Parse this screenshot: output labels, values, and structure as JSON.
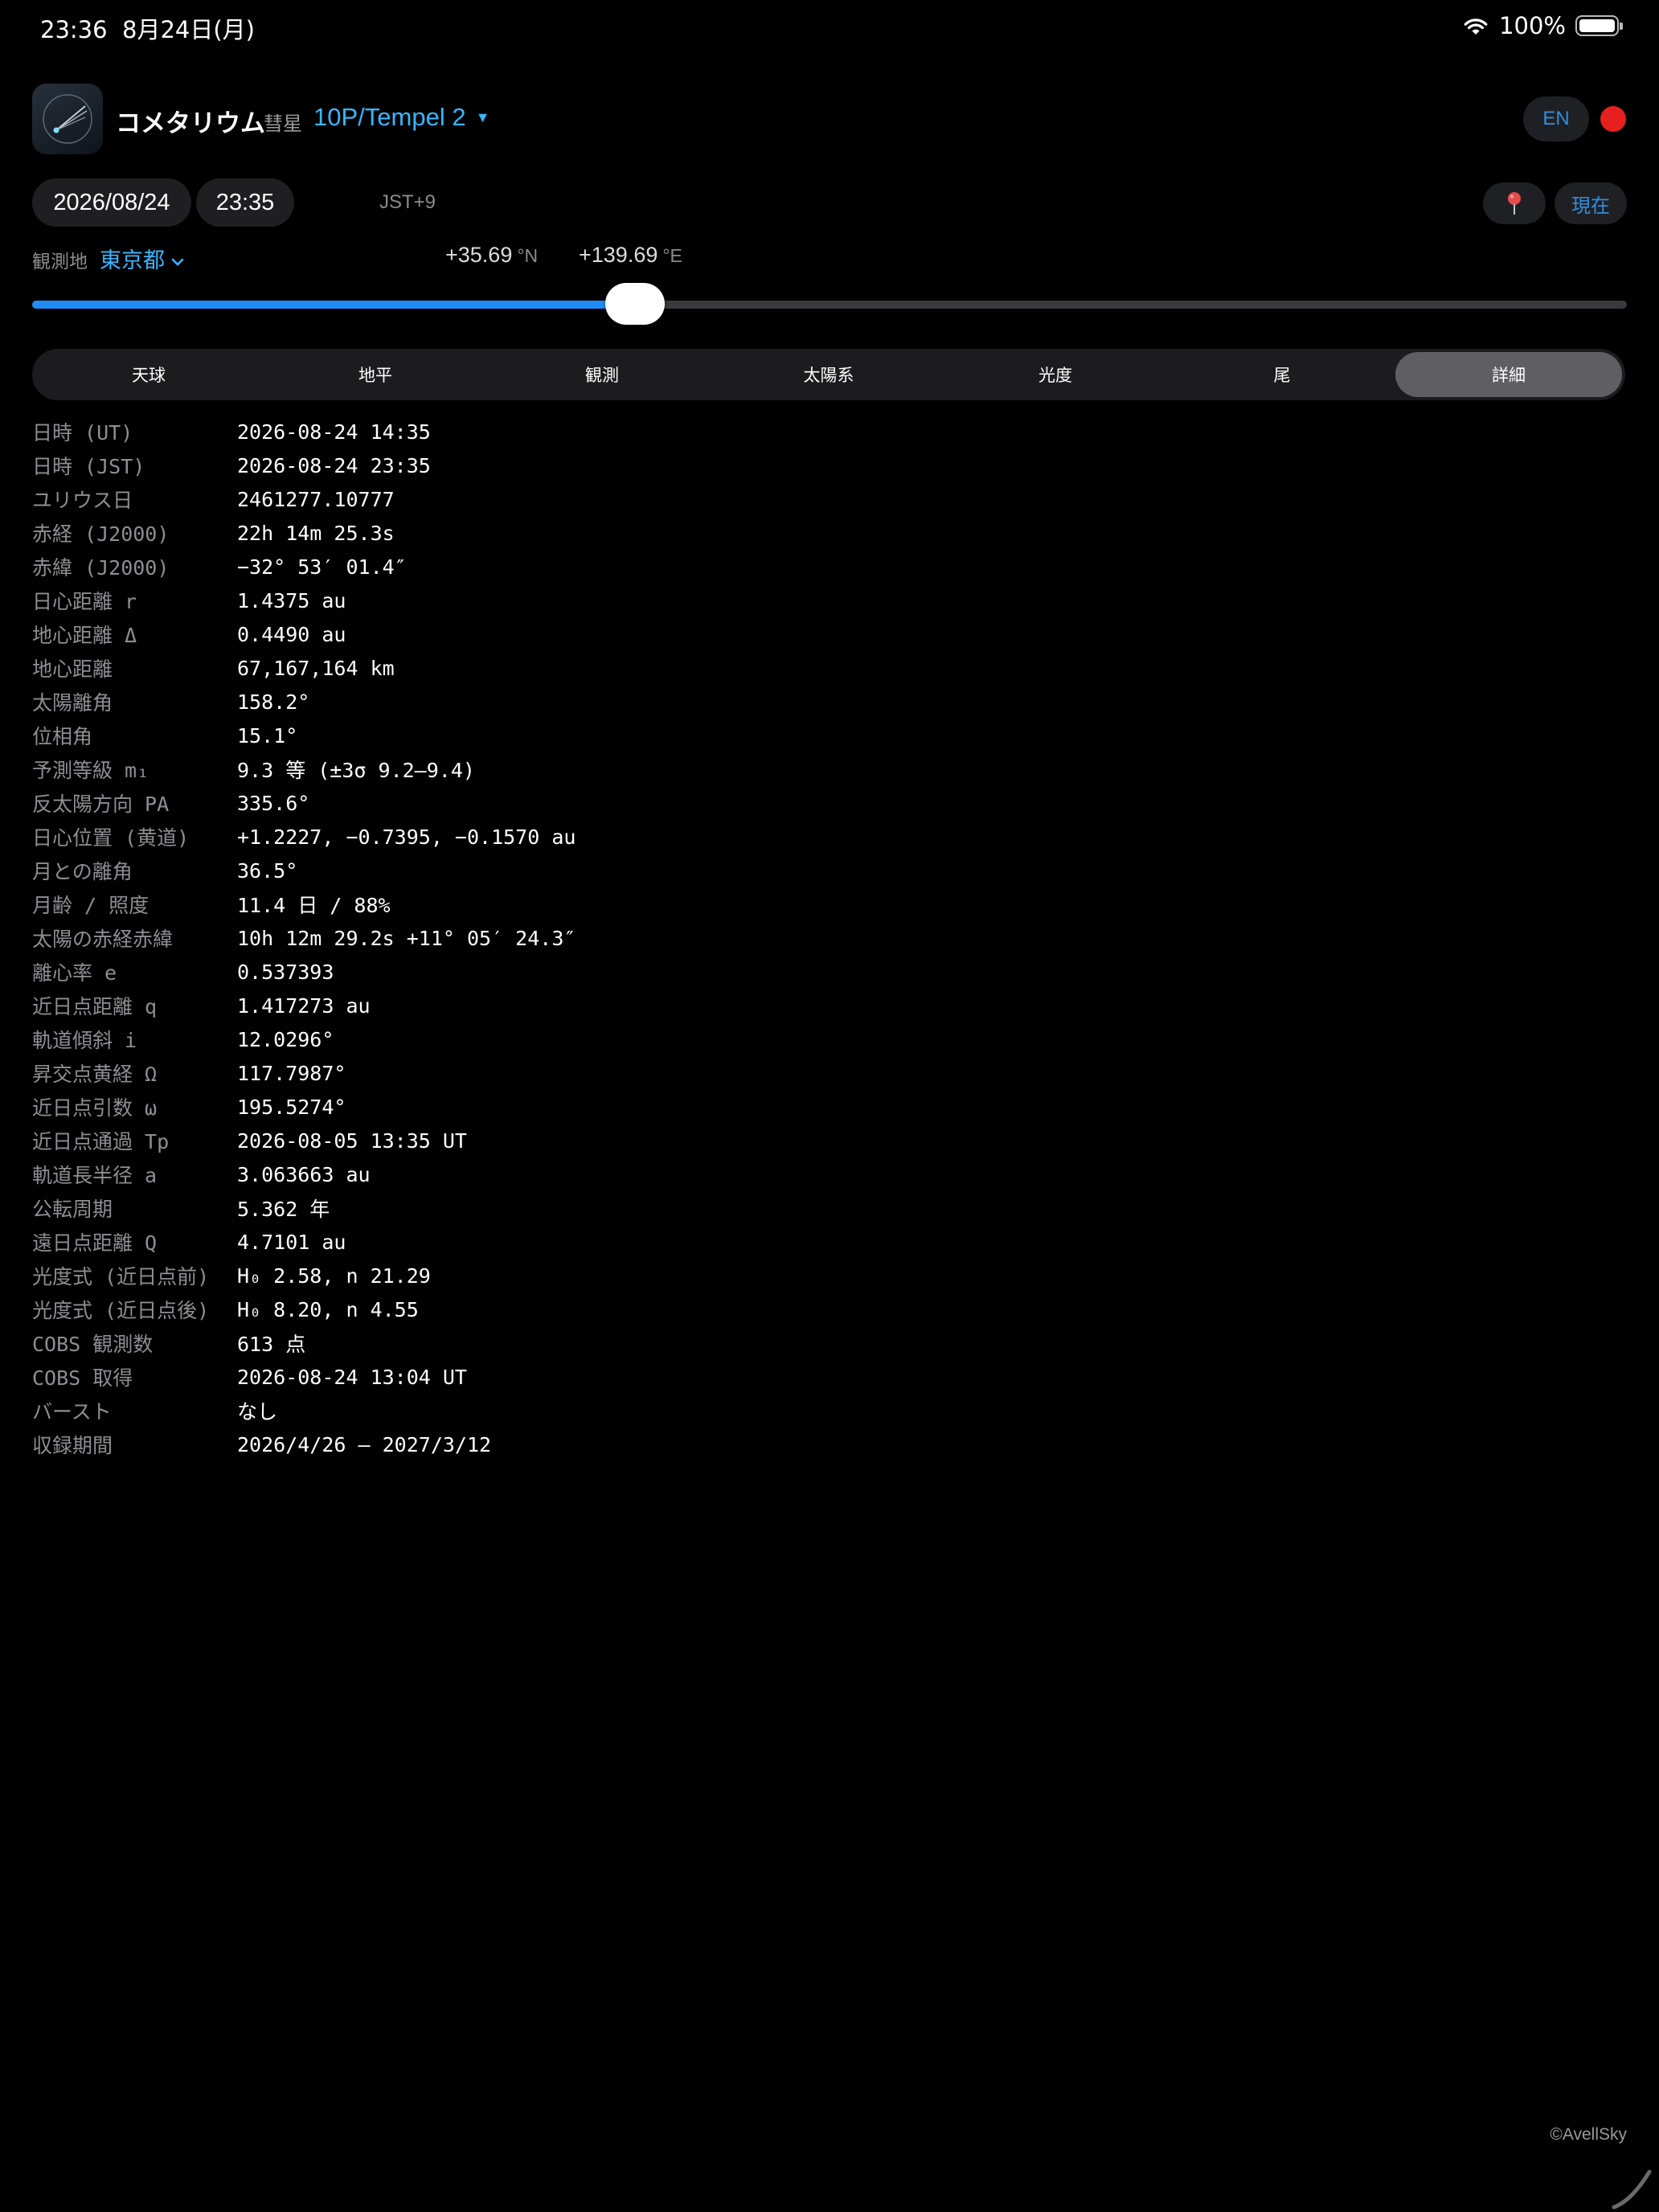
{
  "status_bar": {
    "time": "23:36",
    "date": "8月24日(月)",
    "battery": "100%",
    "icons": [
      "wifi-icon",
      "battery-icon"
    ]
  },
  "header": {
    "app_name": "コメタリウム",
    "subtitle": "彗星",
    "comet": "10P/Tempel 2",
    "lang_button": "EN",
    "record_color": "#e5201e"
  },
  "datetime": {
    "date": "2026/08/24",
    "time": "23:35",
    "timezone": "JST+9",
    "now_button": "現在"
  },
  "location": {
    "label": "観測地",
    "place": "東京都",
    "lat_value": "+35.69",
    "lat_unit": "°N",
    "lon_value": "+139.69",
    "lon_unit": "°E"
  },
  "slider": {
    "fraction": 0.378
  },
  "tabs": [
    {
      "label": "天球",
      "active": false
    },
    {
      "label": "地平",
      "active": false
    },
    {
      "label": "観測",
      "active": false
    },
    {
      "label": "太陽系",
      "active": false
    },
    {
      "label": "光度",
      "active": false
    },
    {
      "label": "尾",
      "active": false
    },
    {
      "label": "詳細",
      "active": true
    }
  ],
  "details": [
    {
      "key": "日時 (UT)",
      "value": "2026-08-24 14:35"
    },
    {
      "key": "日時 (JST)",
      "value": "2026-08-24 23:35"
    },
    {
      "key": "ユリウス日",
      "value": "2461277.10777"
    },
    {
      "key": "赤経 (J2000)",
      "value": "22h 14m 25.3s"
    },
    {
      "key": "赤緯 (J2000)",
      "value": "−32° 53′ 01.4″"
    },
    {
      "key": "日心距離 r",
      "value": "1.4375 au"
    },
    {
      "key": "地心距離 Δ",
      "value": "0.4490 au"
    },
    {
      "key": "地心距離",
      "value": "67,167,164 km"
    },
    {
      "key": "太陽離角",
      "value": "158.2°"
    },
    {
      "key": "位相角",
      "value": "15.1°"
    },
    {
      "key": "予測等級 m₁",
      "value": "9.3 等  (±3σ 9.2–9.4)"
    },
    {
      "key": "反太陽方向 PA",
      "value": "335.6°"
    },
    {
      "key": "日心位置 (黄道)",
      "value": "+1.2227, −0.7395, −0.1570 au"
    },
    {
      "key": "月との離角",
      "value": "36.5°"
    },
    {
      "key": "月齢 / 照度",
      "value": "11.4 日 / 88%"
    },
    {
      "key": "太陽の赤経赤緯",
      "value": "10h 12m 29.2s  +11° 05′ 24.3″"
    },
    {
      "key": "離心率 e",
      "value": "0.537393"
    },
    {
      "key": "近日点距離 q",
      "value": "1.417273 au"
    },
    {
      "key": "軌道傾斜 i",
      "value": "12.0296°"
    },
    {
      "key": "昇交点黄経 Ω",
      "value": "117.7987°"
    },
    {
      "key": "近日点引数 ω",
      "value": "195.5274°"
    },
    {
      "key": "近日点通過 Tp",
      "value": "2026-08-05 13:35 UT"
    },
    {
      "key": "軌道長半径 a",
      "value": "3.063663 au"
    },
    {
      "key": "公転周期",
      "value": "5.362 年"
    },
    {
      "key": "遠日点距離 Q",
      "value": "4.7101 au"
    },
    {
      "key": "光度式 (近日点前)",
      "value": "H₀ 2.58, n 21.29"
    },
    {
      "key": "光度式 (近日点後)",
      "value": "H₀ 8.20, n 4.55"
    },
    {
      "key": "COBS 観測数",
      "value": "613 点"
    },
    {
      "key": "COBS 取得",
      "value": "2026-08-24 13:04 UT"
    },
    {
      "key": "バースト",
      "value": "なし"
    },
    {
      "key": "収録期間",
      "value": "2026/4/26 — 2027/3/12"
    }
  ],
  "footer": {
    "copyright": "©AvellSky"
  }
}
